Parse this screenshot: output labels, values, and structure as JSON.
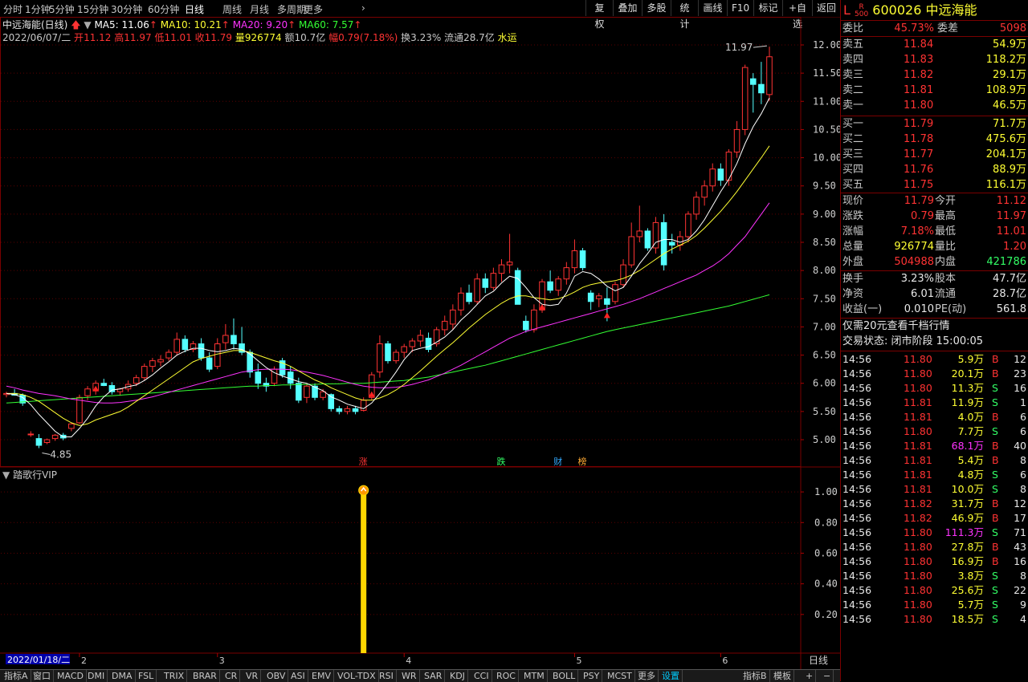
{
  "toolbar": {
    "periods": [
      "分时",
      "1分钟",
      "5分钟",
      "15分钟",
      "30分钟",
      "60分钟",
      "日线",
      "周线",
      "月线",
      "多周期",
      "更多"
    ],
    "active_period": "日线",
    "right_buttons": [
      "复权",
      "叠加",
      "多股",
      "统计",
      "画线",
      "F10",
      "标记",
      "+自选",
      "返回"
    ]
  },
  "legend": {
    "title": "中远海能(日线)",
    "ma5": "MA5: 11.06",
    "ma10": "MA10: 10.21",
    "ma20": "MA20: 9.20",
    "ma60": "MA60: 7.57",
    "info_date": "2022/06/07/二",
    "open_label": "开",
    "open": "11.12",
    "high_label": "高",
    "high": "11.97",
    "low_label": "低",
    "low": "11.01",
    "close_label": "收",
    "close": "11.79",
    "vol_label": "量",
    "vol": "926774",
    "amt": "额10.7亿",
    "amp_label": "幅",
    "amp": "0.79(7.18%)",
    "turnover": "换3.23%",
    "float": "流通28.7亿",
    "sector": "水运"
  },
  "colors": {
    "up": "#ff3333",
    "down": "#54ffff",
    "ma5": "#ffffff",
    "ma10": "#ffff33",
    "ma20": "#ff33ff",
    "ma60": "#33ff33",
    "grid": "#7a0000"
  },
  "chart_data": {
    "type": "candlestick",
    "ylim": [
      4.6,
      12.3
    ],
    "yticks": [
      "12.00",
      "11.50",
      "11.00",
      "10.50",
      "10.00",
      "9.50",
      "9.00",
      "8.50",
      "8.00",
      "7.50",
      "7.00",
      "6.50",
      "6.00",
      "5.50",
      "5.00"
    ],
    "y_values": [
      12.0,
      11.5,
      11.0,
      10.5,
      10.0,
      9.5,
      9.0,
      8.5,
      8.0,
      7.5,
      7.0,
      6.5,
      6.0,
      5.5,
      5.0
    ],
    "high_mark": "11.97",
    "low_mark": "4.85",
    "x_month_labels": [
      "2",
      "3",
      "4",
      "5",
      "6"
    ],
    "candles": [
      [
        5.8,
        5.85,
        5.75,
        5.82
      ],
      [
        5.82,
        5.9,
        5.78,
        5.79
      ],
      [
        5.79,
        5.82,
        5.6,
        5.65
      ],
      [
        5.1,
        5.15,
        5.05,
        5.1
      ],
      [
        5.02,
        5.1,
        4.85,
        4.9
      ],
      [
        4.95,
        5.02,
        4.92,
        5.0
      ],
      [
        5.02,
        5.1,
        4.98,
        5.08
      ],
      [
        5.08,
        5.12,
        4.99,
        5.03
      ],
      [
        5.2,
        5.3,
        5.15,
        5.28
      ],
      [
        5.3,
        5.8,
        5.28,
        5.75
      ],
      [
        5.78,
        5.95,
        5.7,
        5.9
      ],
      [
        5.88,
        6.05,
        5.8,
        6.0
      ],
      [
        6.0,
        6.08,
        5.95,
        5.96
      ],
      [
        5.96,
        6.02,
        5.8,
        5.85
      ],
      [
        5.85,
        5.92,
        5.78,
        5.9
      ],
      [
        5.9,
        6.05,
        5.85,
        5.98
      ],
      [
        6.0,
        6.15,
        5.95,
        6.1
      ],
      [
        6.1,
        6.35,
        6.05,
        6.3
      ],
      [
        6.3,
        6.45,
        6.2,
        6.4
      ],
      [
        6.38,
        6.5,
        6.3,
        6.42
      ],
      [
        6.45,
        6.6,
        6.4,
        6.55
      ],
      [
        6.55,
        6.9,
        6.5,
        6.78
      ],
      [
        6.78,
        6.85,
        6.55,
        6.6
      ],
      [
        6.6,
        6.75,
        6.55,
        6.7
      ],
      [
        6.7,
        6.8,
        6.4,
        6.45
      ],
      [
        6.45,
        6.55,
        6.2,
        6.25
      ],
      [
        6.3,
        6.8,
        6.25,
        6.7
      ],
      [
        6.72,
        7.05,
        6.6,
        6.85
      ],
      [
        6.85,
        7.15,
        6.6,
        6.7
      ],
      [
        6.7,
        7.0,
        6.5,
        6.55
      ],
      [
        6.55,
        6.6,
        6.1,
        6.2
      ],
      [
        6.2,
        6.35,
        5.9,
        6.0
      ],
      [
        6.0,
        6.1,
        5.85,
        5.95
      ],
      [
        6.0,
        6.3,
        5.95,
        6.25
      ],
      [
        6.4,
        6.45,
        6.1,
        6.15
      ],
      [
        6.2,
        6.3,
        5.9,
        6.0
      ],
      [
        6.0,
        6.1,
        5.65,
        5.7
      ],
      [
        5.75,
        6.0,
        5.65,
        5.95
      ],
      [
        5.95,
        6.0,
        5.7,
        5.75
      ],
      [
        5.75,
        5.9,
        5.7,
        5.85
      ],
      [
        5.8,
        5.82,
        5.5,
        5.55
      ],
      [
        5.55,
        5.6,
        5.45,
        5.5
      ],
      [
        5.5,
        5.6,
        5.45,
        5.55
      ],
      [
        5.55,
        5.6,
        5.45,
        5.5
      ],
      [
        5.52,
        5.75,
        5.5,
        5.7
      ],
      [
        5.75,
        6.2,
        5.7,
        6.15
      ],
      [
        6.2,
        6.85,
        6.1,
        6.7
      ],
      [
        6.7,
        6.75,
        6.35,
        6.4
      ],
      [
        6.4,
        6.6,
        6.35,
        6.55
      ],
      [
        6.55,
        6.7,
        6.45,
        6.65
      ],
      [
        6.65,
        6.8,
        6.55,
        6.75
      ],
      [
        6.75,
        6.95,
        6.65,
        6.85
      ],
      [
        6.8,
        6.9,
        6.55,
        6.6
      ],
      [
        6.7,
        7.0,
        6.65,
        6.95
      ],
      [
        6.95,
        7.2,
        6.85,
        7.1
      ],
      [
        7.05,
        7.4,
        6.95,
        7.3
      ],
      [
        7.3,
        7.7,
        7.2,
        7.6
      ],
      [
        7.6,
        7.75,
        7.4,
        7.45
      ],
      [
        7.45,
        7.95,
        7.4,
        7.85
      ],
      [
        7.85,
        7.95,
        7.6,
        7.7
      ],
      [
        7.7,
        8.05,
        7.65,
        7.95
      ],
      [
        7.95,
        8.2,
        7.8,
        8.1
      ],
      [
        8.1,
        8.65,
        7.95,
        8.15
      ],
      [
        8.0,
        8.05,
        7.4,
        7.4
      ],
      [
        7.1,
        7.2,
        6.9,
        6.95
      ],
      [
        6.95,
        7.4,
        6.9,
        7.3
      ],
      [
        7.3,
        7.85,
        7.25,
        7.8
      ],
      [
        7.8,
        8.0,
        7.6,
        7.65
      ],
      [
        7.65,
        7.9,
        7.55,
        7.85
      ],
      [
        7.85,
        8.15,
        7.75,
        8.05
      ],
      [
        8.05,
        8.55,
        7.95,
        8.35
      ],
      [
        8.35,
        8.4,
        8.0,
        8.05
      ],
      [
        7.6,
        7.65,
        7.3,
        7.45
      ],
      [
        7.5,
        7.6,
        7.35,
        7.55
      ],
      [
        7.5,
        7.7,
        7.1,
        7.4
      ],
      [
        7.45,
        7.8,
        7.4,
        7.75
      ],
      [
        7.75,
        8.2,
        7.7,
        8.1
      ],
      [
        8.1,
        8.85,
        8.05,
        8.6
      ],
      [
        8.6,
        9.15,
        8.5,
        8.7
      ],
      [
        8.7,
        8.75,
        8.35,
        8.4
      ],
      [
        8.4,
        8.95,
        8.3,
        8.85
      ],
      [
        8.85,
        9.0,
        8.0,
        8.1
      ],
      [
        8.5,
        8.65,
        8.3,
        8.45
      ],
      [
        8.45,
        8.7,
        8.35,
        8.6
      ],
      [
        8.6,
        9.05,
        8.5,
        9.0
      ],
      [
        9.0,
        9.4,
        8.9,
        9.3
      ],
      [
        9.3,
        9.6,
        9.15,
        9.5
      ],
      [
        9.5,
        9.9,
        9.4,
        9.8
      ],
      [
        9.8,
        9.9,
        9.5,
        9.6
      ],
      [
        9.6,
        10.15,
        9.5,
        10.1
      ],
      [
        10.1,
        10.65,
        10.0,
        10.5
      ],
      [
        10.5,
        11.65,
        10.4,
        11.6
      ],
      [
        11.4,
        11.5,
        10.8,
        11.3
      ],
      [
        11.3,
        11.7,
        10.95,
        11.15
      ],
      [
        11.12,
        11.97,
        11.01,
        11.79
      ]
    ],
    "ma5": [
      5.82,
      5.8,
      5.75,
      5.62,
      5.45,
      5.3,
      5.15,
      5.05,
      5.05,
      5.2,
      5.38,
      5.6,
      5.76,
      5.88,
      5.9,
      5.94,
      5.97,
      6.05,
      6.15,
      6.27,
      6.38,
      6.5,
      6.57,
      6.62,
      6.62,
      6.58,
      6.56,
      6.58,
      6.62,
      6.6,
      6.52,
      6.4,
      6.28,
      6.19,
      6.13,
      6.08,
      6.03,
      6.0,
      5.93,
      5.87,
      5.76,
      5.7,
      5.63,
      5.59,
      5.55,
      5.65,
      5.82,
      6.0,
      6.2,
      6.42,
      6.58,
      6.62,
      6.65,
      6.73,
      6.82,
      6.95,
      7.12,
      7.25,
      7.4,
      7.55,
      7.63,
      7.78,
      7.9,
      7.86,
      7.7,
      7.52,
      7.4,
      7.38,
      7.4,
      7.6,
      7.9,
      7.98,
      7.95,
      7.85,
      7.72,
      7.64,
      7.7,
      7.9,
      8.12,
      8.3,
      8.5,
      8.55,
      8.55,
      8.5,
      8.55,
      8.7,
      8.9,
      9.15,
      9.4,
      9.62,
      9.9,
      10.25,
      10.55,
      10.78,
      11.06
    ],
    "ma10": [
      5.82,
      5.82,
      5.8,
      5.75,
      5.68,
      5.58,
      5.48,
      5.38,
      5.3,
      5.25,
      5.28,
      5.35,
      5.4,
      5.45,
      5.5,
      5.58,
      5.68,
      5.78,
      5.88,
      5.98,
      6.08,
      6.18,
      6.28,
      6.38,
      6.44,
      6.48,
      6.52,
      6.55,
      6.58,
      6.58,
      6.55,
      6.5,
      6.45,
      6.4,
      6.36,
      6.3,
      6.22,
      6.14,
      6.06,
      6.0,
      5.92,
      5.86,
      5.8,
      5.74,
      5.7,
      5.7,
      5.74,
      5.8,
      5.88,
      5.98,
      6.1,
      6.22,
      6.35,
      6.48,
      6.6,
      6.72,
      6.85,
      6.98,
      7.1,
      7.22,
      7.32,
      7.42,
      7.5,
      7.55,
      7.55,
      7.52,
      7.5,
      7.48,
      7.5,
      7.55,
      7.62,
      7.7,
      7.75,
      7.78,
      7.8,
      7.82,
      7.86,
      7.92,
      8.0,
      8.1,
      8.2,
      8.3,
      8.38,
      8.45,
      8.52,
      8.62,
      8.75,
      8.9,
      9.05,
      9.22,
      9.4,
      9.6,
      9.8,
      10.0,
      10.21
    ],
    "ma20": [
      5.95,
      5.92,
      5.88,
      5.85,
      5.82,
      5.8,
      5.78,
      5.75,
      5.72,
      5.7,
      5.68,
      5.66,
      5.65,
      5.65,
      5.66,
      5.68,
      5.7,
      5.73,
      5.76,
      5.8,
      5.84,
      5.88,
      5.92,
      5.96,
      6.0,
      6.04,
      6.08,
      6.12,
      6.16,
      6.2,
      6.22,
      6.24,
      6.25,
      6.25,
      6.25,
      6.24,
      6.22,
      6.2,
      6.17,
      6.14,
      6.1,
      6.06,
      6.02,
      5.98,
      5.95,
      5.93,
      5.92,
      5.92,
      5.93,
      5.95,
      5.98,
      6.02,
      6.06,
      6.12,
      6.18,
      6.25,
      6.32,
      6.4,
      6.48,
      6.56,
      6.64,
      6.72,
      6.8,
      6.86,
      6.92,
      6.96,
      7.0,
      7.04,
      7.08,
      7.12,
      7.16,
      7.2,
      7.24,
      7.28,
      7.32,
      7.36,
      7.4,
      7.45,
      7.5,
      7.56,
      7.62,
      7.68,
      7.74,
      7.8,
      7.86,
      7.92,
      8.0,
      8.08,
      8.18,
      8.3,
      8.45,
      8.6,
      8.8,
      9.0,
      9.2
    ],
    "ma60": [
      5.65,
      5.66,
      5.67,
      5.68,
      5.69,
      5.7,
      5.71,
      5.72,
      5.73,
      5.74,
      5.75,
      5.76,
      5.77,
      5.78,
      5.79,
      5.8,
      5.81,
      5.82,
      5.83,
      5.84,
      5.85,
      5.86,
      5.87,
      5.88,
      5.89,
      5.9,
      5.91,
      5.92,
      5.93,
      5.94,
      5.95,
      5.95,
      5.96,
      5.96,
      5.97,
      5.97,
      5.98,
      5.98,
      5.98,
      5.99,
      5.99,
      5.99,
      6.0,
      6.0,
      6.0,
      6.01,
      6.02,
      6.03,
      6.04,
      6.05,
      6.07,
      6.09,
      6.11,
      6.14,
      6.17,
      6.2,
      6.23,
      6.26,
      6.29,
      6.32,
      6.36,
      6.4,
      6.44,
      6.48,
      6.52,
      6.56,
      6.6,
      6.64,
      6.68,
      6.72,
      6.76,
      6.8,
      6.84,
      6.88,
      6.92,
      6.95,
      6.98,
      7.01,
      7.04,
      7.07,
      7.1,
      7.13,
      7.16,
      7.19,
      7.22,
      7.25,
      7.28,
      7.31,
      7.34,
      7.37,
      7.41,
      7.45,
      7.49,
      7.53,
      7.57
    ],
    "event_markers": [
      {
        "index": 44,
        "label": "涨",
        "color": "#ff3333"
      },
      {
        "index": 61,
        "label": "跌",
        "color": "#33ff66"
      },
      {
        "index": 68,
        "label": "财",
        "color": "#33aaff"
      },
      {
        "index": 71,
        "label": "榜",
        "color": "#ffaa33"
      }
    ],
    "signal_arrows": [
      {
        "index": 11,
        "dir": "up"
      },
      {
        "index": 45,
        "dir": "up"
      },
      {
        "index": 66,
        "dir": "up"
      },
      {
        "index": 74,
        "dir": "up"
      }
    ]
  },
  "indicator": {
    "title": "踏歌行VIP",
    "yticks": [
      "1.00",
      "0.80",
      "0.60",
      "0.40",
      "0.20"
    ],
    "y_values": [
      1.0,
      0.8,
      0.6,
      0.4,
      0.2
    ],
    "signal_index": 44,
    "signal_value": 1.0
  },
  "xaxis": {
    "date_label": "2022/01/18/二",
    "period_label": "日线"
  },
  "bottom_tabs": [
    "指标A",
    "窗口",
    "MACD",
    "DMI",
    "DMA",
    "FSL",
    "TRIX",
    "BRAR",
    "CR",
    "VR",
    "OBV",
    "ASI",
    "EMV",
    "VOL-TDX",
    "RSI",
    "WR",
    "SAR",
    "KDJ",
    "CCI",
    "ROC",
    "MTM",
    "BOLL",
    "PSY",
    "MCST",
    "更多",
    "设置",
    "指标B",
    "模板",
    "+",
    "−"
  ],
  "quote": {
    "code": "600026",
    "name": "中远海能",
    "weibi_label": "委比",
    "weibi": "45.73%",
    "weicha_label": "委差",
    "weicha": "5098",
    "asks": [
      {
        "label": "卖五",
        "price": "11.84",
        "vol": "54.9万"
      },
      {
        "label": "卖四",
        "price": "11.83",
        "vol": "118.2万"
      },
      {
        "label": "卖三",
        "price": "11.82",
        "vol": "29.1万"
      },
      {
        "label": "卖二",
        "price": "11.81",
        "vol": "108.9万"
      },
      {
        "label": "卖一",
        "price": "11.80",
        "vol": "46.5万"
      }
    ],
    "bids": [
      {
        "label": "买一",
        "price": "11.79",
        "vol": "71.7万"
      },
      {
        "label": "买二",
        "price": "11.78",
        "vol": "475.6万"
      },
      {
        "label": "买三",
        "price": "11.77",
        "vol": "204.1万"
      },
      {
        "label": "买四",
        "price": "11.76",
        "vol": "88.9万"
      },
      {
        "label": "买五",
        "price": "11.75",
        "vol": "116.1万"
      }
    ],
    "stats": [
      {
        "l1": "现价",
        "v1": "11.79",
        "c1": "red",
        "l2": "今开",
        "v2": "11.12",
        "c2": "red"
      },
      {
        "l1": "涨跌",
        "v1": "0.79",
        "c1": "red",
        "l2": "最高",
        "v2": "11.97",
        "c2": "red"
      },
      {
        "l1": "涨幅",
        "v1": "7.18%",
        "c1": "red",
        "l2": "最低",
        "v2": "11.01",
        "c2": "red"
      },
      {
        "l1": "总量",
        "v1": "926774",
        "c1": "yellow",
        "l2": "量比",
        "v2": "1.20",
        "c2": "red"
      },
      {
        "l1": "外盘",
        "v1": "504988",
        "c1": "red",
        "l2": "内盘",
        "v2": "421786",
        "c2": "green"
      }
    ],
    "fin": [
      {
        "l1": "换手",
        "v1": "3.23%",
        "l2": "股本",
        "v2": "47.7亿"
      },
      {
        "l1": "净资",
        "v1": "6.01",
        "l2": "流通",
        "v2": "28.7亿"
      },
      {
        "l1": "收益(一)",
        "v1": "0.010",
        "l2": "PE(动)",
        "v2": "561.8"
      }
    ],
    "promo": "仅需20元查看千档行情",
    "status": "交易状态: 闭市阶段 15:00:05",
    "ticks": [
      {
        "t": "14:56",
        "p": "11.80",
        "v": "5.9万",
        "s": "B",
        "n": "12"
      },
      {
        "t": "14:56",
        "p": "11.80",
        "v": "20.1万",
        "s": "B",
        "n": "23"
      },
      {
        "t": "14:56",
        "p": "11.80",
        "v": "11.3万",
        "s": "S",
        "n": "16"
      },
      {
        "t": "14:56",
        "p": "11.81",
        "v": "11.9万",
        "s": "S",
        "n": "1"
      },
      {
        "t": "14:56",
        "p": "11.81",
        "v": "4.0万",
        "s": "B",
        "n": "6"
      },
      {
        "t": "14:56",
        "p": "11.80",
        "v": "7.7万",
        "s": "S",
        "n": "6"
      },
      {
        "t": "14:56",
        "p": "11.81",
        "v": "68.1万",
        "s": "B",
        "n": "40"
      },
      {
        "t": "14:56",
        "p": "11.81",
        "v": "5.4万",
        "s": "B",
        "n": "8"
      },
      {
        "t": "14:56",
        "p": "11.81",
        "v": "4.8万",
        "s": "S",
        "n": "6"
      },
      {
        "t": "14:56",
        "p": "11.81",
        "v": "10.0万",
        "s": "S",
        "n": "8"
      },
      {
        "t": "14:56",
        "p": "11.82",
        "v": "31.7万",
        "s": "B",
        "n": "12"
      },
      {
        "t": "14:56",
        "p": "11.82",
        "v": "46.9万",
        "s": "B",
        "n": "17"
      },
      {
        "t": "14:56",
        "p": "11.80",
        "v": "111.3万",
        "s": "S",
        "n": "71"
      },
      {
        "t": "14:56",
        "p": "11.80",
        "v": "27.8万",
        "s": "B",
        "n": "43"
      },
      {
        "t": "14:56",
        "p": "11.80",
        "v": "16.9万",
        "s": "B",
        "n": "16"
      },
      {
        "t": "14:56",
        "p": "11.80",
        "v": "3.8万",
        "s": "S",
        "n": "8"
      },
      {
        "t": "14:56",
        "p": "11.80",
        "v": "25.6万",
        "s": "S",
        "n": "22"
      },
      {
        "t": "14:56",
        "p": "11.80",
        "v": "5.7万",
        "s": "S",
        "n": "9"
      },
      {
        "t": "14:56",
        "p": "11.80",
        "v": "18.5万",
        "s": "S",
        "n": "4"
      }
    ]
  }
}
